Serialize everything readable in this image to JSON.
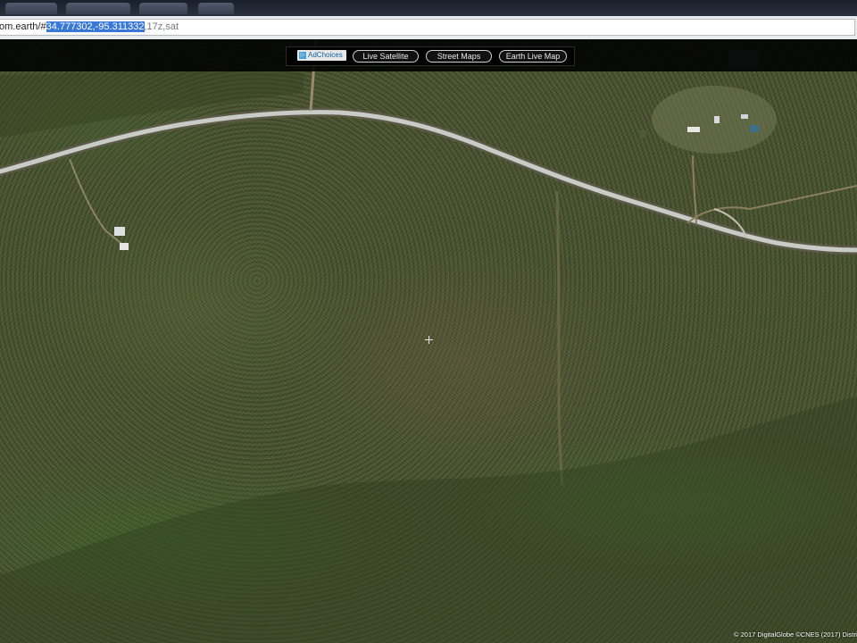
{
  "address_bar": {
    "url_prefix": "om.earth/#",
    "url_selected": "34.777302,-95.311332",
    "url_suffix": ",17z,sat"
  },
  "toolbar": {
    "adchoices_label": "AdChoices",
    "buttons": [
      {
        "label": "Live Satellite"
      },
      {
        "label": "Street Maps"
      },
      {
        "label": "Earth Live Map"
      }
    ]
  },
  "map": {
    "attribution": "© 2017 DigitalGlobe ©CNES (2017) Distri",
    "center_marker_icon": "crosshair-icon"
  },
  "colors": {
    "selection": "#3a78d8",
    "toolbar_bg": "#000000",
    "road": "#c9ccc6",
    "forest_dark": "#3e4a2a",
    "forest_brown": "#6a5e44"
  }
}
